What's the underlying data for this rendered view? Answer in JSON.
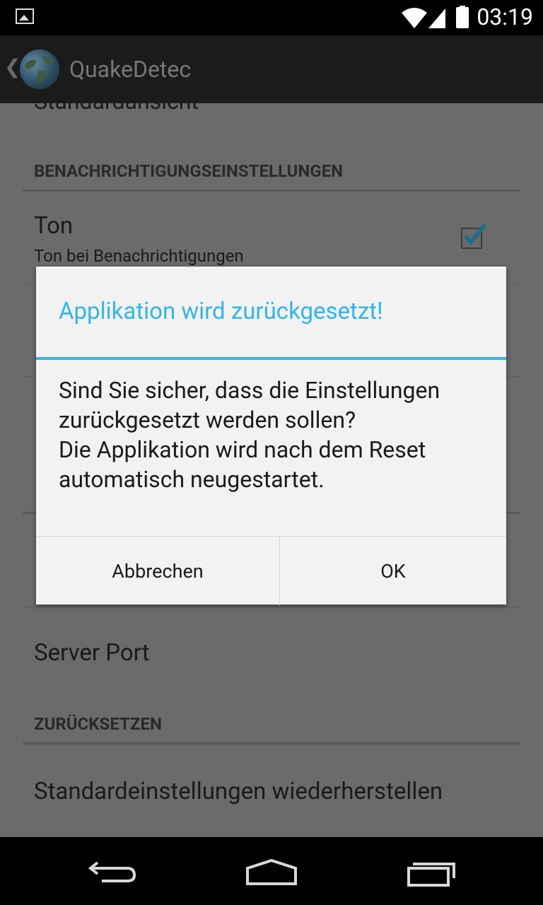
{
  "status_bar": {
    "time": "03:19"
  },
  "action_bar": {
    "title": "QuakeDetec",
    "back": "❮"
  },
  "background": {
    "cut_item": "Standardansicht",
    "section_notifications": "BENACHRICHTIGUNGSEINSTELLUNGEN",
    "tone_title": "Ton",
    "tone_summary": "Ton bei Benachrichtigungen",
    "server_port": "Server Port",
    "section_reset": "ZURÜCKSETZEN",
    "restore_defaults": "Standardeinstellungen wiederherstellen"
  },
  "dialog": {
    "title": "Applikation wird zurückgesetzt!",
    "message": "Sind Sie sicher, dass die Einstellungen zurückgesetzt werden sollen?\nDie Applikation wird nach dem Reset automatisch neugestartet.",
    "cancel_label": "Abbrechen",
    "ok_label": "OK"
  },
  "colors": {
    "accent": "#33b5e5",
    "dim_bg": "#6b6b6b",
    "dialog_bg": "#f2f2f2"
  }
}
